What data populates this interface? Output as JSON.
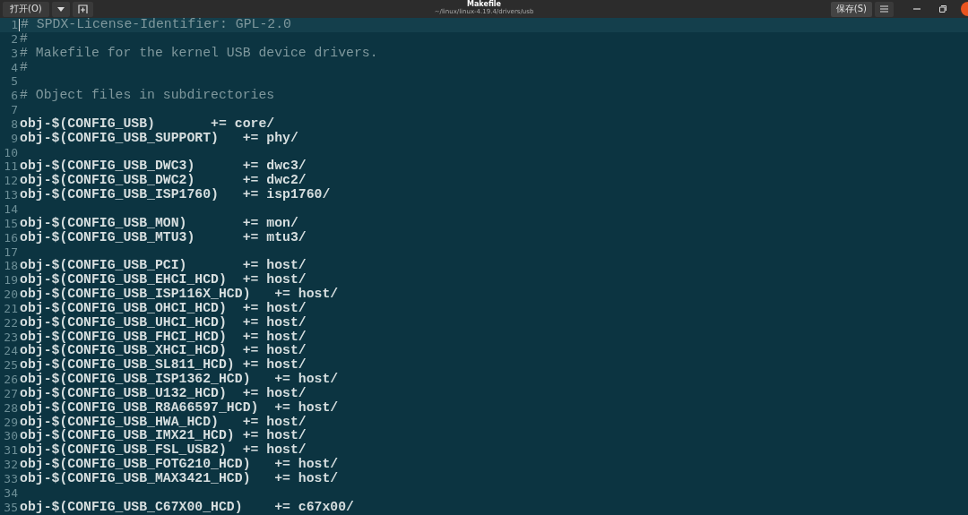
{
  "header": {
    "open_button": "打开(O)",
    "title": "Makefile",
    "subtitle": "~/linux/linux-4.19.4/drivers/usb",
    "save_button": "保存(S)"
  },
  "lines": [
    {
      "number": "1",
      "kind": "comment",
      "text": "# SPDX-License-Identifier: GPL-2.0",
      "current": true
    },
    {
      "number": "2",
      "kind": "comment",
      "text": "#",
      "current": false
    },
    {
      "number": "3",
      "kind": "comment",
      "text": "# Makefile for the kernel USB device drivers.",
      "current": false
    },
    {
      "number": "4",
      "kind": "comment",
      "text": "#",
      "current": false
    },
    {
      "number": "5",
      "current": false
    },
    {
      "number": "6",
      "kind": "comment",
      "text": "# Object files in subdirectories",
      "current": false
    },
    {
      "number": "7",
      "current": false
    },
    {
      "number": "8",
      "kind": "code",
      "text": "obj-$(CONFIG_USB)       += core/",
      "current": false
    },
    {
      "number": "9",
      "kind": "code",
      "text": "obj-$(CONFIG_USB_SUPPORT)   += phy/",
      "current": false
    },
    {
      "number": "10",
      "current": false
    },
    {
      "number": "11",
      "kind": "code",
      "text": "obj-$(CONFIG_USB_DWC3)      += dwc3/",
      "current": false
    },
    {
      "number": "12",
      "kind": "code",
      "text": "obj-$(CONFIG_USB_DWC2)      += dwc2/",
      "current": false
    },
    {
      "number": "13",
      "kind": "code",
      "text": "obj-$(CONFIG_USB_ISP1760)   += isp1760/",
      "current": false
    },
    {
      "number": "14",
      "current": false
    },
    {
      "number": "15",
      "kind": "code",
      "text": "obj-$(CONFIG_USB_MON)       += mon/",
      "current": false
    },
    {
      "number": "16",
      "kind": "code",
      "text": "obj-$(CONFIG_USB_MTU3)      += mtu3/",
      "current": false
    },
    {
      "number": "17",
      "current": false
    },
    {
      "number": "18",
      "kind": "code",
      "text": "obj-$(CONFIG_USB_PCI)       += host/",
      "current": false
    },
    {
      "number": "19",
      "kind": "code",
      "text": "obj-$(CONFIG_USB_EHCI_HCD)  += host/",
      "current": false
    },
    {
      "number": "20",
      "kind": "code",
      "text": "obj-$(CONFIG_USB_ISP116X_HCD)   += host/",
      "current": false
    },
    {
      "number": "21",
      "kind": "code",
      "text": "obj-$(CONFIG_USB_OHCI_HCD)  += host/",
      "current": false
    },
    {
      "number": "22",
      "kind": "code",
      "text": "obj-$(CONFIG_USB_UHCI_HCD)  += host/",
      "current": false
    },
    {
      "number": "23",
      "kind": "code",
      "text": "obj-$(CONFIG_USB_FHCI_HCD)  += host/",
      "current": false
    },
    {
      "number": "24",
      "kind": "code",
      "text": "obj-$(CONFIG_USB_XHCI_HCD)  += host/",
      "current": false
    },
    {
      "number": "25",
      "kind": "code",
      "text": "obj-$(CONFIG_USB_SL811_HCD) += host/",
      "current": false
    },
    {
      "number": "26",
      "kind": "code",
      "text": "obj-$(CONFIG_USB_ISP1362_HCD)   += host/",
      "current": false
    },
    {
      "number": "27",
      "kind": "code",
      "text": "obj-$(CONFIG_USB_U132_HCD)  += host/",
      "current": false
    },
    {
      "number": "28",
      "kind": "code",
      "text": "obj-$(CONFIG_USB_R8A66597_HCD)  += host/",
      "current": false
    },
    {
      "number": "29",
      "kind": "code",
      "text": "obj-$(CONFIG_USB_HWA_HCD)   += host/",
      "current": false
    },
    {
      "number": "30",
      "kind": "code",
      "text": "obj-$(CONFIG_USB_IMX21_HCD) += host/",
      "current": false
    },
    {
      "number": "31",
      "kind": "code",
      "text": "obj-$(CONFIG_USB_FSL_USB2)  += host/",
      "current": false
    },
    {
      "number": "32",
      "kind": "code",
      "text": "obj-$(CONFIG_USB_FOTG210_HCD)   += host/",
      "current": false
    },
    {
      "number": "33",
      "kind": "code",
      "text": "obj-$(CONFIG_USB_MAX3421_HCD)   += host/",
      "current": false
    },
    {
      "number": "34",
      "current": false
    },
    {
      "number": "35",
      "kind": "code",
      "text": "obj-$(CONFIG_USB_C67X00_HCD)    += c67x00/",
      "current": false
    }
  ]
}
